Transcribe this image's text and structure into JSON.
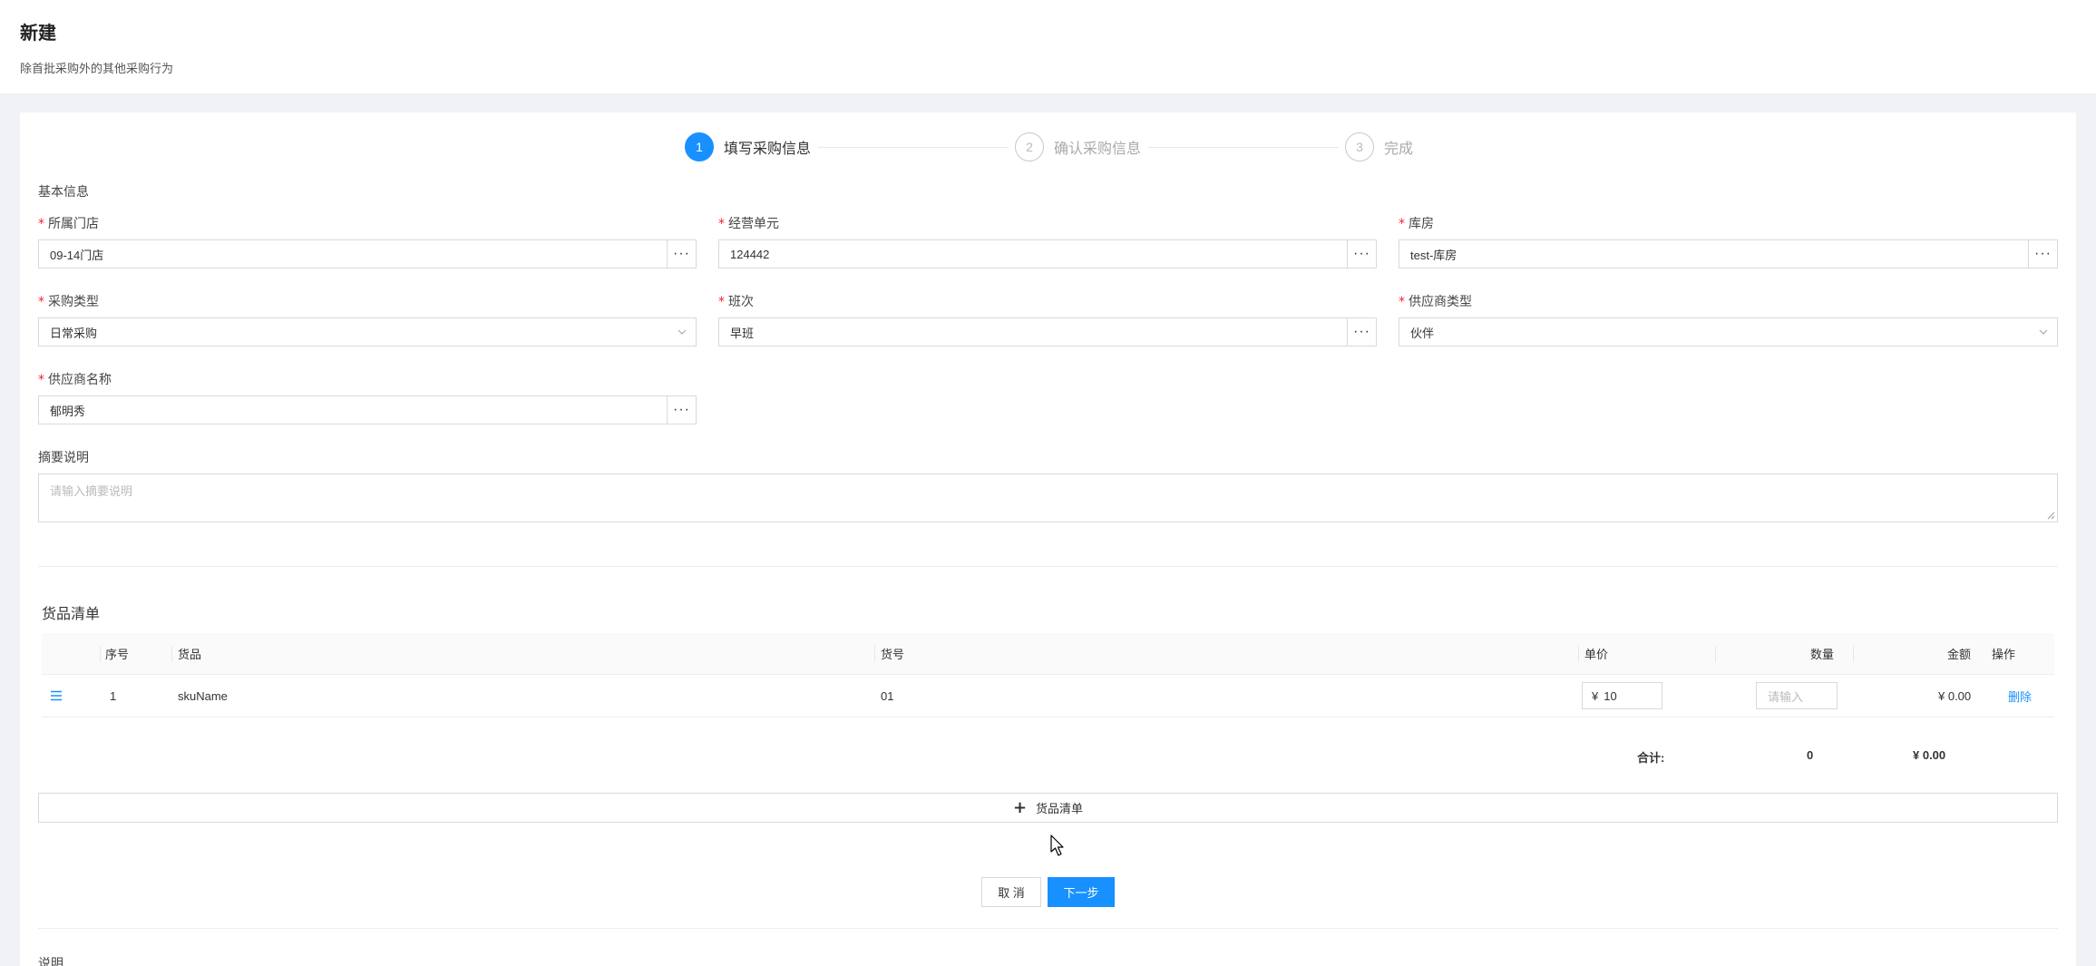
{
  "header": {
    "title": "新建",
    "description": "除首批采购外的其他采购行为"
  },
  "steps": [
    {
      "number": "1",
      "label": "填写采购信息",
      "active": true
    },
    {
      "number": "2",
      "label": "确认采购信息",
      "active": false
    },
    {
      "number": "3",
      "label": "完成",
      "active": false
    }
  ],
  "basic_info": {
    "section_label": "基本信息",
    "store": {
      "label": "所属门店",
      "value": "09-14门店"
    },
    "business_unit": {
      "label": "经营单元",
      "value": "124442"
    },
    "warehouse": {
      "label": "库房",
      "value": "test-库房"
    },
    "purchase_type": {
      "label": "采购类型",
      "value": "日常采购"
    },
    "shift": {
      "label": "班次",
      "value": "早班"
    },
    "supplier_type": {
      "label": "供应商类型",
      "value": "伙伴"
    },
    "supplier_name": {
      "label": "供应商名称",
      "value": "郁明秀"
    },
    "summary": {
      "label": "摘要说明",
      "placeholder": "请输入摘要说明"
    }
  },
  "goods": {
    "title": "货品清单",
    "columns": {
      "index": "序号",
      "goods": "货品",
      "code": "货号",
      "unit_price": "单价",
      "quantity": "数量",
      "amount": "金额",
      "action": "操作"
    },
    "rows": [
      {
        "index": "1",
        "goods": "skuName",
        "code": "01",
        "currency": "¥",
        "unit_price": "10",
        "quantity_placeholder": "请输入",
        "amount": "¥ 0.00",
        "action": "删除"
      }
    ],
    "total_label": "合计:",
    "total_quantity": "0",
    "total_amount": "¥ 0.00",
    "add_label": "货品清单"
  },
  "actions": {
    "cancel": "取 消",
    "next": "下一步"
  },
  "note_label": "说明",
  "colors": {
    "primary": "#1890ff",
    "required": "#f5222d"
  }
}
